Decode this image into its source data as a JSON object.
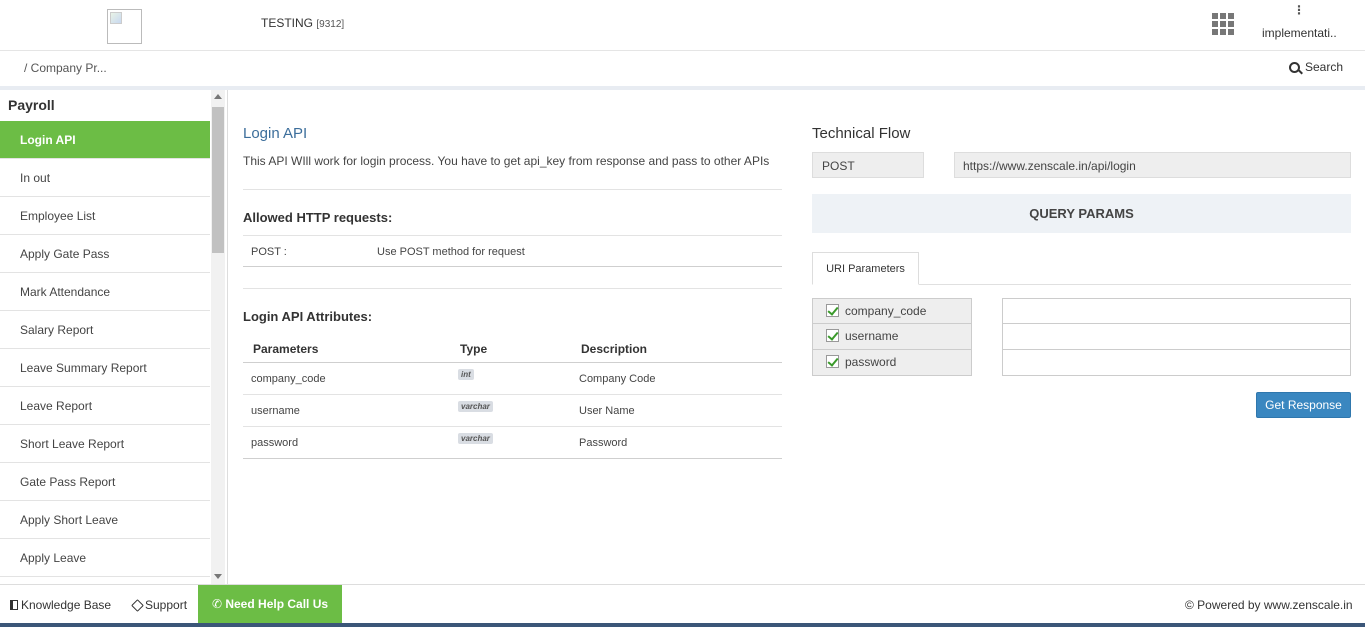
{
  "header": {
    "company_name": "TESTING",
    "company_code": "[9312]",
    "user_name": "implementati..",
    "user_menu_glyph": "⋮"
  },
  "breadcrumb": {
    "text": "/ Company Pr..."
  },
  "search": {
    "label": "Search"
  },
  "sidebar": {
    "title": "Payroll",
    "items": [
      {
        "label": "Login API",
        "active": true
      },
      {
        "label": "In out"
      },
      {
        "label": "Employee List"
      },
      {
        "label": "Apply Gate Pass"
      },
      {
        "label": "Mark Attendance"
      },
      {
        "label": "Salary Report"
      },
      {
        "label": "Leave Summary Report"
      },
      {
        "label": "Leave Report"
      },
      {
        "label": "Short Leave Report"
      },
      {
        "label": "Gate Pass Report"
      },
      {
        "label": "Apply Short Leave"
      },
      {
        "label": "Apply Leave"
      }
    ]
  },
  "api": {
    "title": "Login API",
    "description": "This API WIll work for login process. You have to get api_key from response and pass to other APIs",
    "requests_heading": "Allowed HTTP requests:",
    "request": {
      "method": "POST :",
      "text": "Use POST method for request"
    },
    "attributes_heading": "Login API Attributes:",
    "columns": {
      "param": "Parameters",
      "type": "Type",
      "desc": "Description"
    },
    "attributes": [
      {
        "param": "company_code",
        "type": "int",
        "desc": "Company Code"
      },
      {
        "param": "username",
        "type": "varchar",
        "desc": "User Name"
      },
      {
        "param": "password",
        "type": "varchar",
        "desc": "Password"
      }
    ]
  },
  "flow": {
    "title": "Technical Flow",
    "method": "POST",
    "url": "https://www.zenscale.in/api/login",
    "query_params": "QUERY PARAMS",
    "tab": "URI Parameters",
    "params": [
      "company_code",
      "username",
      "password"
    ],
    "button": "Get Response"
  },
  "footer": {
    "knowledge_base": "Knowledge Base",
    "support": "Support",
    "help": "Need Help Call Us",
    "powered": "© Powered by www.zenscale.in"
  },
  "colors": {
    "accent_green": "#6cbd45",
    "link_blue": "#3c6e9b",
    "button_blue": "#3a87c0"
  }
}
